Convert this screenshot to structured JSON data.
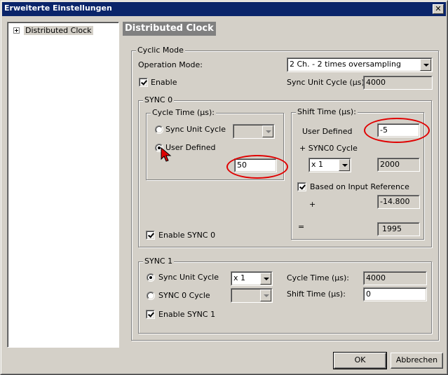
{
  "window": {
    "title": "Erweiterte Einstellungen",
    "close_icon": "close-icon"
  },
  "tree": {
    "items": [
      {
        "label": "Distributed Clock",
        "expand_icon": "plus-icon",
        "selected": true
      }
    ]
  },
  "panel": {
    "title": "Distributed Clock"
  },
  "cyclic_mode": {
    "group_label": "Cyclic Mode",
    "operation_mode_label": "Operation Mode:",
    "operation_mode_value": "2 Ch. - 2 times oversampling",
    "enable_label": "Enable",
    "enable_checked": true,
    "sync_unit_cycle_label": "Sync Unit Cycle (µs):",
    "sync_unit_cycle_value": "4000"
  },
  "sync0": {
    "group_label": "SYNC 0",
    "cycle_time": {
      "group_label": "Cycle Time (µs):",
      "sync_unit_cycle_label": "Sync Unit Cycle",
      "sync_unit_cycle_selected": false,
      "sync_unit_cycle_combo_value": "",
      "user_defined_label": "User Defined",
      "user_defined_selected": true,
      "user_defined_value": "50"
    },
    "shift_time": {
      "group_label": "Shift Time (µs):",
      "user_defined_label": "User Defined",
      "user_defined_value": "-5",
      "sync0_cycle_label": "+ SYNC0 Cycle",
      "multiplier_value": "x 1",
      "sync0_cycle_value": "2000",
      "based_on_input_label": "Based on Input Reference",
      "based_on_input_checked": true,
      "plus_label": "+",
      "input_reference_value": "-14.800",
      "equals_label": "=",
      "result_value": "1995"
    },
    "enable_label": "Enable SYNC 0",
    "enable_checked": true
  },
  "sync1": {
    "group_label": "SYNC 1",
    "sync_unit_cycle_label": "Sync Unit Cycle",
    "sync_unit_cycle_selected": true,
    "sync_unit_multiplier_value": "x 1",
    "sync0_cycle_label": "SYNC 0 Cycle",
    "sync0_cycle_selected": false,
    "sync0_cycle_combo_value": "",
    "cycle_time_label": "Cycle Time (µs):",
    "cycle_time_value": "4000",
    "shift_time_label": "Shift Time (µs):",
    "shift_time_value": "0",
    "enable_label": "Enable SYNC 1",
    "enable_checked": true
  },
  "buttons": {
    "ok_label": "OK",
    "cancel_label": "Abbrechen"
  },
  "annotations": {
    "color": "#e00000"
  }
}
